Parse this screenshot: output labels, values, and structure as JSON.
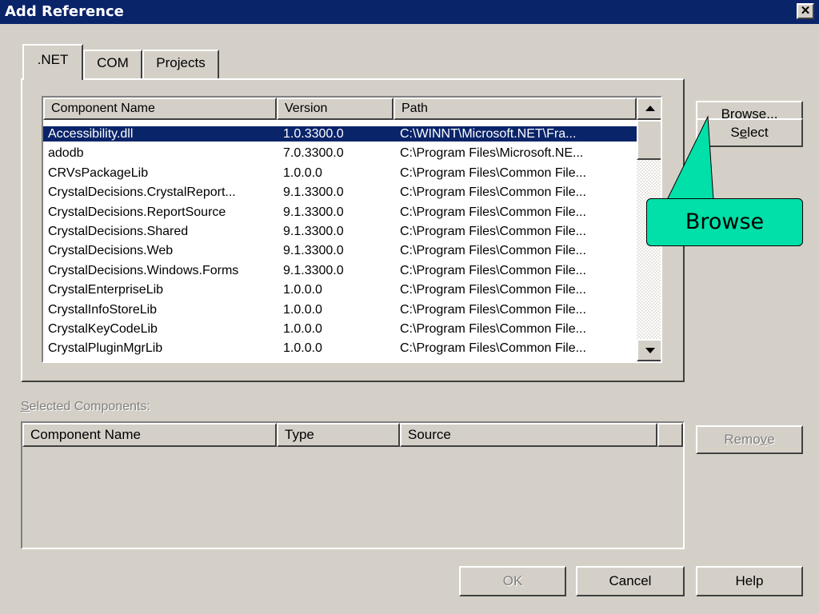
{
  "window": {
    "title": "Add Reference",
    "close_glyph": "✕"
  },
  "tabs": [
    {
      "label": ".NET",
      "active": true
    },
    {
      "label": "COM",
      "active": false
    },
    {
      "label": "Projects",
      "active": false
    }
  ],
  "components_list": {
    "columns": [
      "Component Name",
      "Version",
      "Path"
    ],
    "rows": [
      {
        "name": "Accessibility.dll",
        "version": "1.0.3300.0",
        "path": "C:\\WINNT\\Microsoft.NET\\Fra...",
        "selected": true
      },
      {
        "name": "adodb",
        "version": "7.0.3300.0",
        "path": "C:\\Program Files\\Microsoft.NE..."
      },
      {
        "name": "CRVsPackageLib",
        "version": "1.0.0.0",
        "path": "C:\\Program Files\\Common File..."
      },
      {
        "name": "CrystalDecisions.CrystalReport...",
        "version": "9.1.3300.0",
        "path": "C:\\Program Files\\Common File..."
      },
      {
        "name": "CrystalDecisions.ReportSource",
        "version": "9.1.3300.0",
        "path": "C:\\Program Files\\Common File..."
      },
      {
        "name": "CrystalDecisions.Shared",
        "version": "9.1.3300.0",
        "path": "C:\\Program Files\\Common File..."
      },
      {
        "name": "CrystalDecisions.Web",
        "version": "9.1.3300.0",
        "path": "C:\\Program Files\\Common File..."
      },
      {
        "name": "CrystalDecisions.Windows.Forms",
        "version": "9.1.3300.0",
        "path": "C:\\Program Files\\Common File..."
      },
      {
        "name": "CrystalEnterpriseLib",
        "version": "1.0.0.0",
        "path": "C:\\Program Files\\Common File..."
      },
      {
        "name": "CrystalInfoStoreLib",
        "version": "1.0.0.0",
        "path": "C:\\Program Files\\Common File..."
      },
      {
        "name": "CrystalKeyCodeLib",
        "version": "1.0.0.0",
        "path": "C:\\Program Files\\Common File..."
      },
      {
        "name": "CrystalPluginMgrLib",
        "version": "1.0.0.0",
        "path": "C:\\Program Files\\Common File..."
      }
    ]
  },
  "buttons": {
    "browse": {
      "pre": "",
      "accel": "B",
      "post": "rowse..."
    },
    "select": {
      "pre": "S",
      "accel": "e",
      "post": "lect"
    },
    "remove": {
      "pre": "Remo",
      "accel": "v",
      "post": "e"
    },
    "ok": "OK",
    "cancel": "Cancel",
    "help": "Help"
  },
  "selected_components": {
    "label_accel": "S",
    "label_rest": "elected Components:",
    "columns": [
      "Component Name",
      "Type",
      "Source"
    ]
  },
  "callout": {
    "text": "Browse",
    "color": "#00e0a8"
  },
  "colors": {
    "titlebar": "#0a246a",
    "dialog_bg": "#d4d0c8",
    "selection": "#0a246a"
  }
}
